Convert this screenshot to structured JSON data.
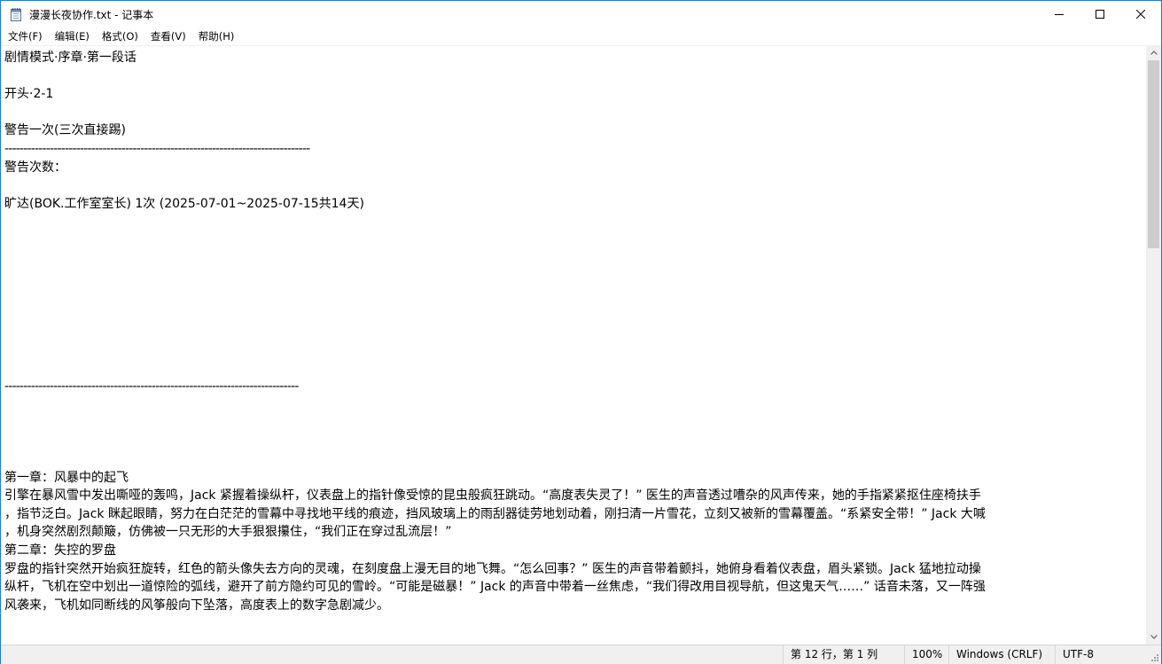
{
  "window": {
    "title": "漫漫长夜协作.txt - 记事本"
  },
  "menu": {
    "items": [
      "文件(F)",
      "编辑(E)",
      "格式(O)",
      "查看(V)",
      "帮助(H)"
    ]
  },
  "editor": {
    "lines": [
      "剧情模式·序章·第一段话",
      "",
      "开头·2-1",
      "",
      "警告一次(三次直接踢)",
      "---------------------------------------------------------------------------------",
      "警告次数：",
      "",
      "旷达(BOK.工作室室长) 1次 (2025-07-01~2025-07-15共14天)",
      "",
      "",
      "",
      "",
      "",
      "",
      "",
      "",
      "",
      "------------------------------------------------------------------------------",
      "",
      "",
      "",
      "",
      "第一章：风暴中的起飞",
      "引擎在暴风雪中发出嘶哑的轰鸣，Jack 紧握着操纵杆，仪表盘上的指针像受惊的昆虫般疯狂跳动。“高度表失灵了！” 医生的声音透过嘈杂的风声传来，她的手指紧紧抠住座椅扶手",
      "，指节泛白。Jack 眯起眼睛，努力在白茫茫的雪幕中寻找地平线的痕迹，挡风玻璃上的雨刮器徒劳地划动着，刚扫清一片雪花，立刻又被新的雪幕覆盖。“系紧安全带！” Jack 大喊",
      "，机身突然剧烈颠簸，仿佛被一只无形的大手狠狠攥住，“我们正在穿过乱流层！”",
      "第二章：失控的罗盘",
      "罗盘的指针突然开始疯狂旋转，红色的箭头像失去方向的灵魂，在刻度盘上漫无目的地飞舞。“怎么回事？” 医生的声音带着颤抖，她俯身看着仪表盘，眉头紧锁。Jack 猛地拉动操",
      "纵杆，飞机在空中划出一道惊险的弧线，避开了前方隐约可见的雪岭。“可能是磁暴！” Jack 的声音中带着一丝焦虑，“我们得改用目视导航，但这鬼天气……” 话音未落，又一阵强",
      "风袭来，飞机如同断线的风筝般向下坠落，高度表上的数字急剧减少。"
    ]
  },
  "status": {
    "position": "第 12 行，第 1 列",
    "zoom": "100%",
    "line_ending": "Windows (CRLF)",
    "encoding": "UTF-8"
  }
}
